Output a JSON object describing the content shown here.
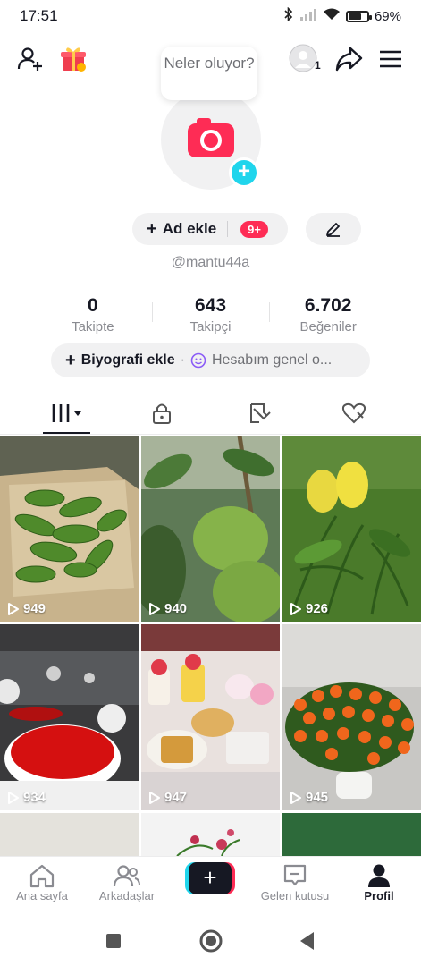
{
  "status_bar": {
    "time": "17:51",
    "battery": "69",
    "battery_level": 0.69
  },
  "profile": {
    "bubble_text": "Neler oluyor?",
    "name_button": "Ad ekle",
    "name_badge": "9+",
    "username": "@mantu44a",
    "friends_badge": "1"
  },
  "stats": [
    {
      "value": "0",
      "label": "Takipte"
    },
    {
      "value": "643",
      "label": "Takipçi"
    },
    {
      "value": "6.702",
      "label": "Beğeniler"
    }
  ],
  "bio": {
    "add_label": "Biyografi ekle",
    "separator": "·",
    "overview_label": "Hesabım genel o..."
  },
  "tabs": [
    "videos-tab",
    "private-tab",
    "reposts-tab",
    "liked-tab"
  ],
  "videos": [
    {
      "views": "949",
      "scene": "cucumbers"
    },
    {
      "views": "940",
      "scene": "guava-tree"
    },
    {
      "views": "926",
      "scene": "garden-greens"
    },
    {
      "views": "934",
      "scene": "roses-balloons"
    },
    {
      "views": "947",
      "scene": "hello-kitty-waffles"
    },
    {
      "views": "945",
      "scene": "orange-roses"
    }
  ],
  "bottom_nav": {
    "home": "Ana sayfa",
    "friends": "Arkadaşlar",
    "inbox": "Gelen kutusu",
    "profile": "Profil"
  },
  "colors": {
    "accent": "#fe2c55",
    "cyan": "#20d5ec",
    "text": "#161823",
    "muted": "#8a8b91"
  }
}
